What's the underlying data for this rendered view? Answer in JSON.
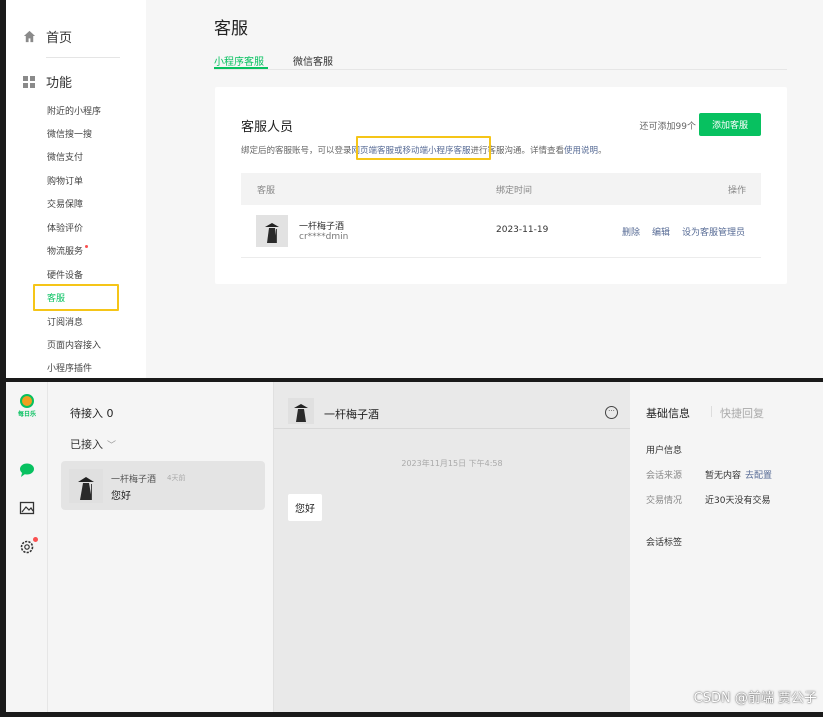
{
  "top": {
    "sidebar": {
      "home_label": "首页",
      "function_label": "功能",
      "items": [
        {
          "label": "附近的小程序"
        },
        {
          "label": "微信搜一搜"
        },
        {
          "label": "微信支付"
        },
        {
          "label": "购物订单"
        },
        {
          "label": "交易保障"
        },
        {
          "label": "体验评价"
        },
        {
          "label": "物流服务"
        },
        {
          "label": "硬件设备"
        },
        {
          "label": "客服"
        },
        {
          "label": "订阅消息"
        },
        {
          "label": "页面内容接入"
        },
        {
          "label": "小程序插件"
        }
      ]
    },
    "page_title": "客服",
    "tabs": [
      {
        "label": "小程序客服"
      },
      {
        "label": "微信客服"
      }
    ],
    "card": {
      "title": "客服人员",
      "remaining": "还可添加99个",
      "add_button": "添加客服",
      "desc_prefix": "绑定后的客服账号，可以登录",
      "desc_link": "网页端客服或移动端小程序客服",
      "desc_middle": "进行客服沟通。详情查看",
      "desc_help": "使用说明",
      "desc_suffix": "。",
      "columns": {
        "agent": "客服",
        "bind_time": "绑定时间",
        "actions": "操作"
      },
      "row": {
        "name": "一杆梅子酒",
        "account": "cr****dmin",
        "bind_date": "2023-11-19",
        "action_delete": "删除",
        "action_edit": "编辑",
        "action_admin": "设为客服管理员"
      }
    }
  },
  "bottom": {
    "logo_text": "每日乐",
    "queue": {
      "pending_label": "待接入 0",
      "accepted_label": "已接入",
      "conversation": {
        "name": "一杆梅子酒",
        "time": "4天前",
        "message": "您好"
      }
    },
    "chat": {
      "name": "一杆梅子酒",
      "more": "···",
      "timestamp": "2023年11月15日 下午4:58",
      "message": "您好"
    },
    "info": {
      "tab_basic": "基础信息",
      "tab_quick": "快捷回复",
      "user_info": "用户信息",
      "source_label": "会话来源",
      "source_value": "暂无内容",
      "source_link": "去配置",
      "trade_label": "交易情况",
      "trade_value": "近30天没有交易",
      "tags_label": "会话标签"
    }
  },
  "watermark": "CSDN @前端 贾公子",
  "colors": {
    "accent": "#07c160",
    "link": "#576b95",
    "highlight": "#f5c518"
  }
}
